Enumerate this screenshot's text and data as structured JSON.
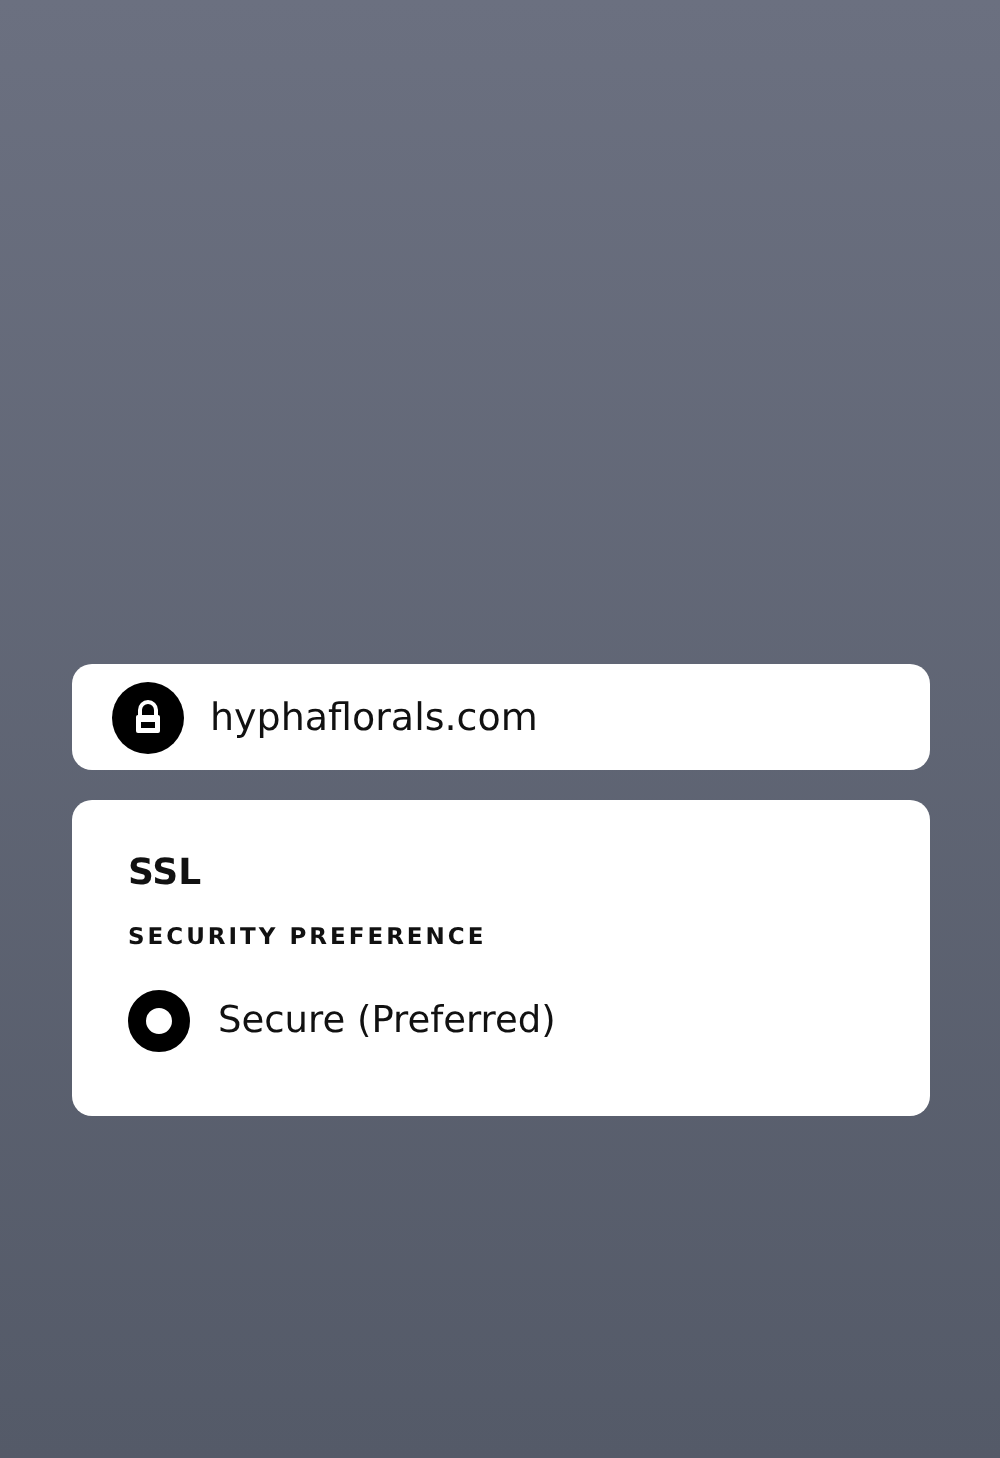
{
  "site": {
    "domain": "hyphaflorals.com",
    "secure": true
  },
  "ssl_panel": {
    "title": "SSL",
    "section_label": "SECURITY PREFERENCE",
    "options": [
      {
        "label": "Secure (Preferred)",
        "selected": true
      }
    ]
  }
}
